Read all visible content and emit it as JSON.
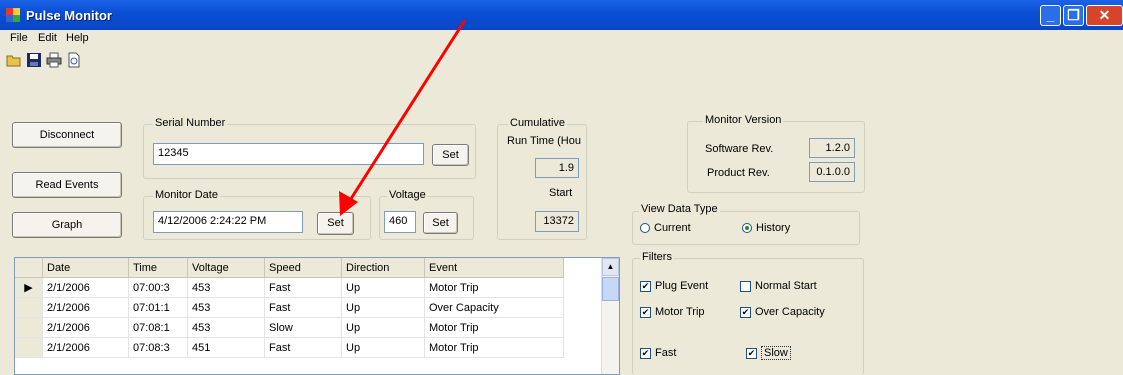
{
  "window": {
    "title": "Pulse Monitor",
    "min_icon": "minimize-icon",
    "max_icon": "restore-icon",
    "close_icon": "close-icon"
  },
  "menu": [
    "File",
    "Edit",
    "Help"
  ],
  "toolbar": [
    "open-folder-icon",
    "save-icon",
    "print-icon",
    "print-preview-icon"
  ],
  "buttons": {
    "disconnect": "Disconnect",
    "read_events": "Read Events",
    "graph": "Graph"
  },
  "serial": {
    "label": "Serial Number",
    "value": "12345",
    "set_label": "Set"
  },
  "monitor_date": {
    "label": "Monitor Date",
    "value": "4/12/2006 2:24:22 PM",
    "set_label": "Set"
  },
  "voltage": {
    "label": "Voltage",
    "value": "460",
    "set_label": "Set"
  },
  "cumulative": {
    "label": "Cumulative",
    "run_label": "Run  Time (Hou",
    "run_value": "1.9",
    "start_label": "Start",
    "start_value": "13372"
  },
  "version": {
    "label": "Monitor Version",
    "software_label": "Software Rev.",
    "software_value": "1.2.0",
    "product_label": "Product Rev.",
    "product_value": "0.1.0.0"
  },
  "view_type": {
    "label": "View Data Type",
    "options": [
      "Current",
      "History"
    ],
    "selected": "History"
  },
  "filters": {
    "label": "Filters",
    "plug_event": "Plug Event",
    "normal_start": "Normal Start",
    "motor_trip": "Motor Trip",
    "over_capacity": "Over Capacity",
    "fast": "Fast",
    "slow": "Slow"
  },
  "grid": {
    "columns": [
      "Date",
      "Time",
      "Voltage",
      "Speed",
      "Direction",
      "Event"
    ],
    "rows": [
      [
        "2/1/2006",
        "07:00:3",
        "453",
        "Fast",
        "Up",
        "Motor Trip"
      ],
      [
        "2/1/2006",
        "07:01:1",
        "453",
        "Fast",
        "Up",
        "Over Capacity"
      ],
      [
        "2/1/2006",
        "07:08:1",
        "453",
        "Slow",
        "Up",
        "Motor Trip"
      ],
      [
        "2/1/2006",
        "07:08:3",
        "451",
        "Fast",
        "Up",
        "Motor Trip"
      ]
    ]
  },
  "annotation": {
    "arrow_color": "#ff0000"
  }
}
